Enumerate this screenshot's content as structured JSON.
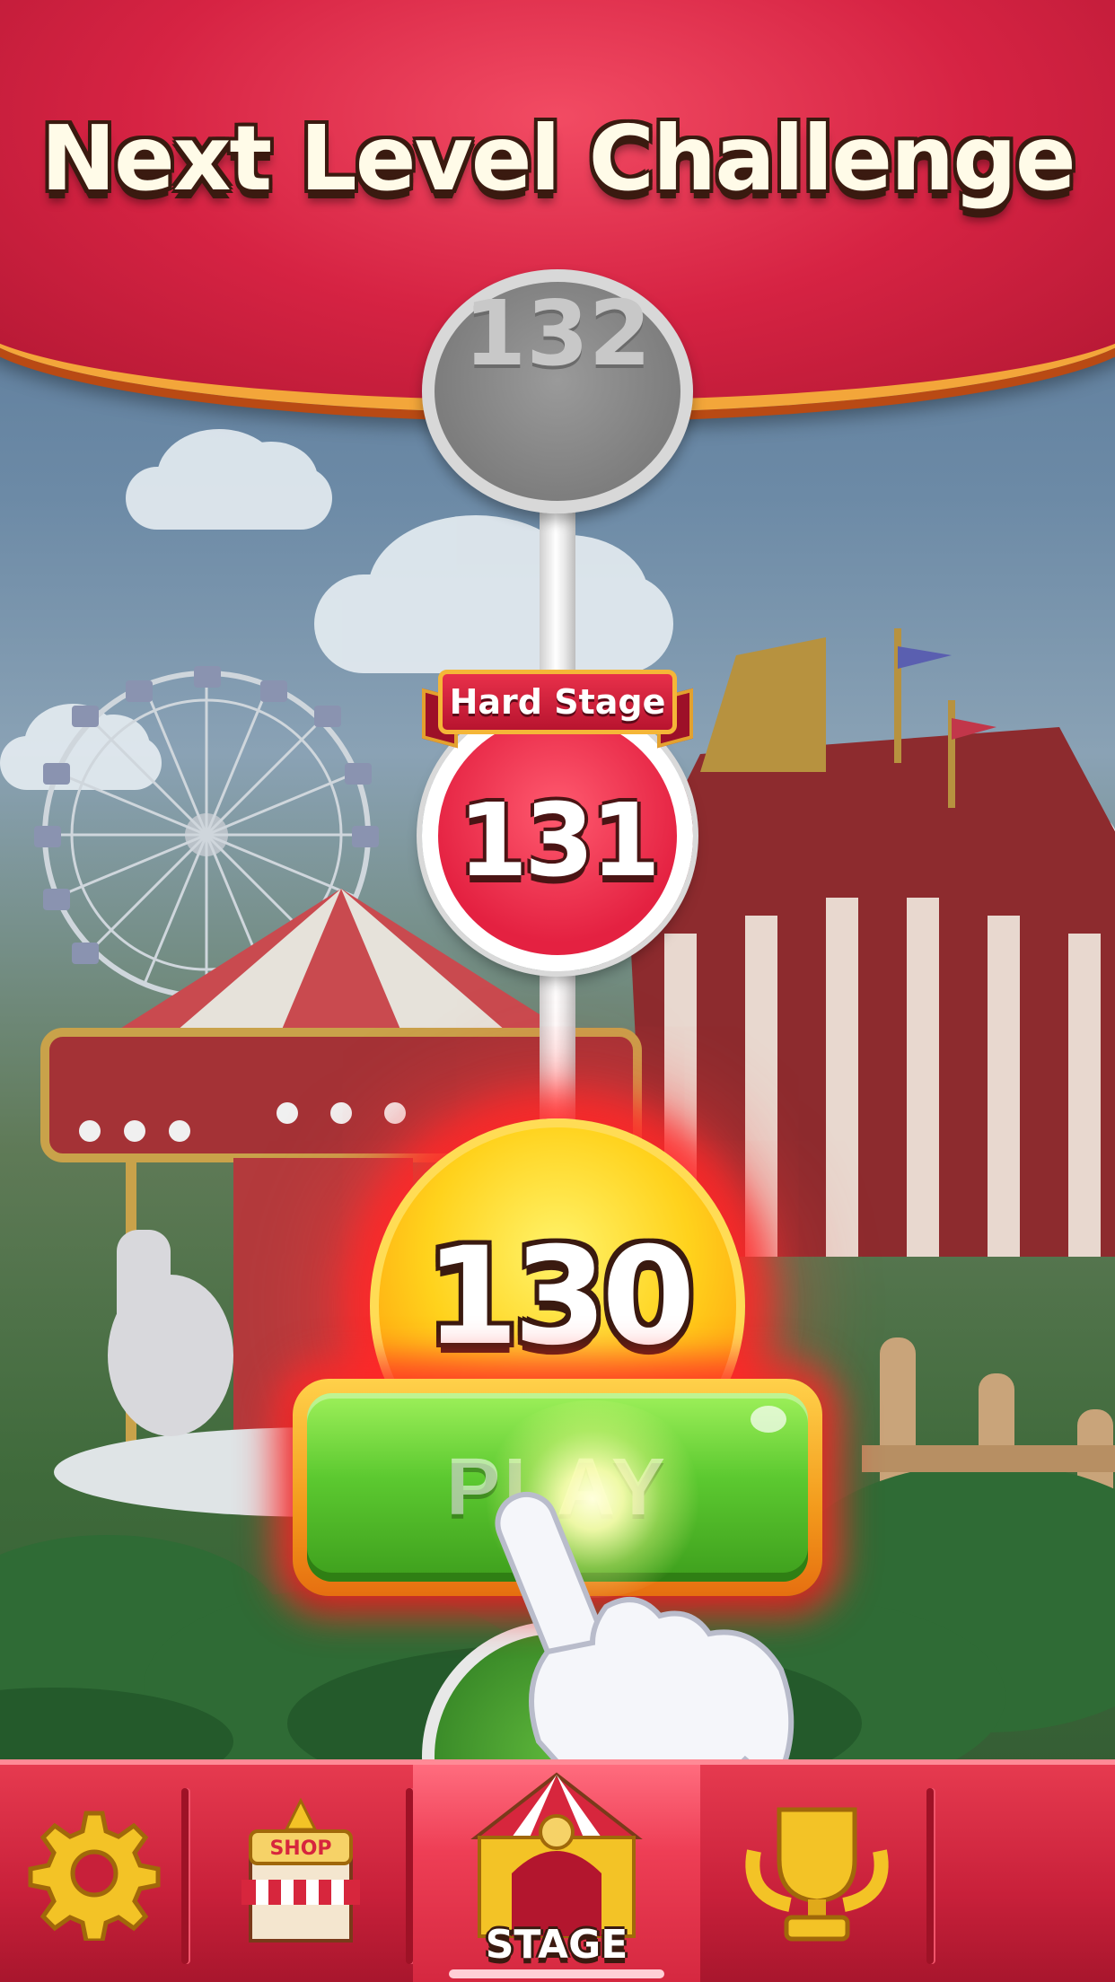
{
  "header": {
    "title": "Next Level Challenge"
  },
  "levels": {
    "upcoming": {
      "number": "132"
    },
    "hard": {
      "number": "131",
      "badge": "Hard Stage"
    },
    "current": {
      "number": "130",
      "play_label": "PLAY"
    }
  },
  "bottom_nav": {
    "items": [
      {
        "id": "settings",
        "icon": "gear-icon"
      },
      {
        "id": "shop",
        "icon": "shop-icon",
        "sign": "SHOP"
      },
      {
        "id": "stage",
        "icon": "stage-tent-icon",
        "label": "STAGE",
        "active": true
      },
      {
        "id": "rankings",
        "icon": "trophy-icon"
      }
    ]
  },
  "colors": {
    "header_red": "#d62343",
    "gold_trim": "#f3a63a",
    "play_green": "#5cc930",
    "hard_red": "#e42141",
    "current_yellow": "#ffd21c"
  }
}
